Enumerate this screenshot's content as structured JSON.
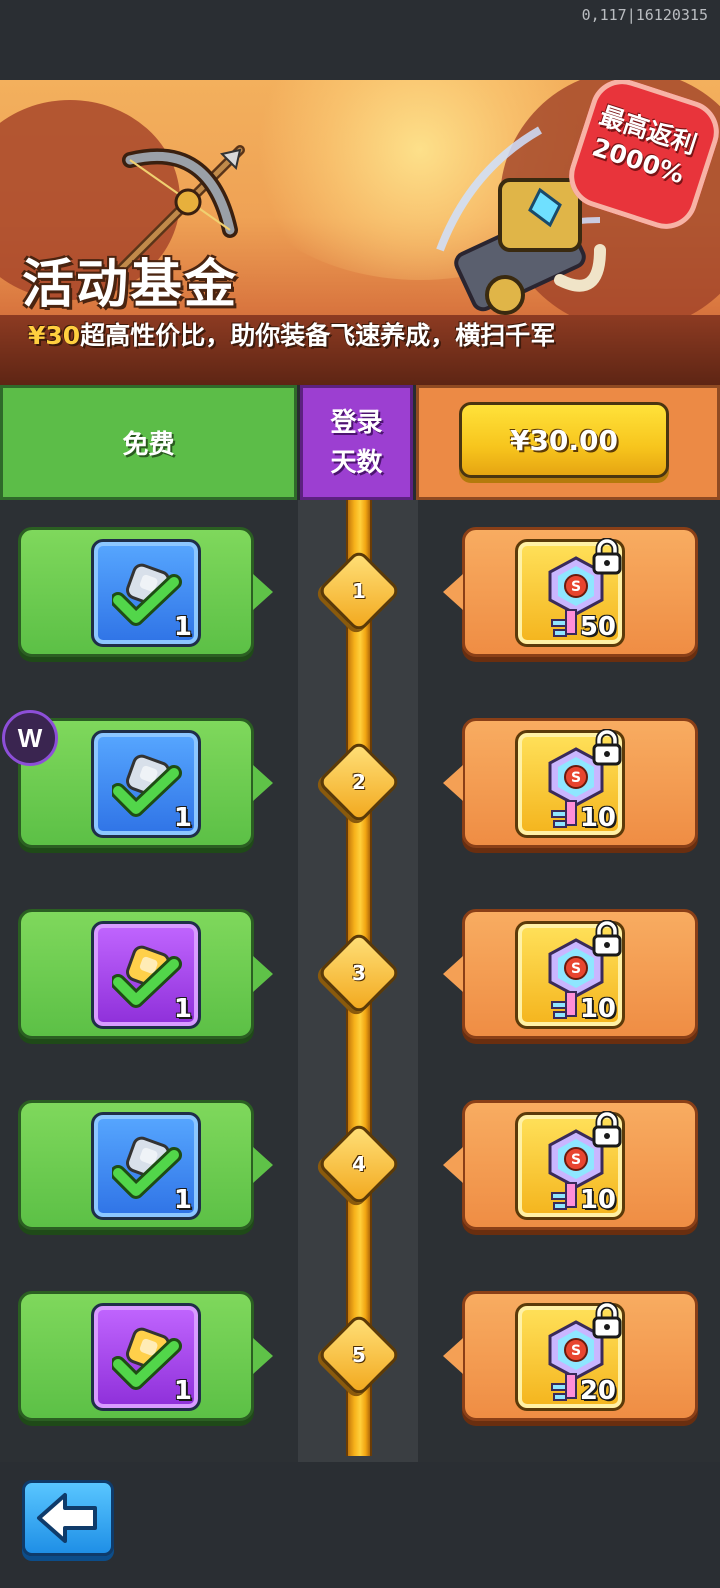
{
  "status_bar": {
    "debug_text": "0,117|16120315"
  },
  "banner": {
    "title": "活动基金",
    "subtitle_price": "¥30",
    "subtitle_text": "超高性价比，助你装备飞速养成，横扫千军",
    "badge_line1": "最高返利",
    "badge_line2": "2000%"
  },
  "header": {
    "free_label": "免费",
    "days_label_line1": "登录",
    "days_label_line2": "天数",
    "price_button": "¥30.00"
  },
  "rows": [
    {
      "day": "1",
      "free_item": {
        "icon": "blue-check-item-icon",
        "qty": "1"
      },
      "paid_item": {
        "icon": "rainbow-key-icon",
        "qty": "50",
        "locked": true
      }
    },
    {
      "day": "2",
      "free_item": {
        "icon": "blue-check-item-icon",
        "qty": "1"
      },
      "paid_item": {
        "icon": "rainbow-key-icon",
        "qty": "10",
        "locked": true
      }
    },
    {
      "day": "3",
      "free_item": {
        "icon": "purple-check-item-icon",
        "qty": "1"
      },
      "paid_item": {
        "icon": "rainbow-key-icon",
        "qty": "10",
        "locked": true
      }
    },
    {
      "day": "4",
      "free_item": {
        "icon": "blue-check-item-icon",
        "qty": "1"
      },
      "paid_item": {
        "icon": "rainbow-key-icon",
        "qty": "10",
        "locked": true
      }
    },
    {
      "day": "5",
      "free_item": {
        "icon": "purple-check-item-icon",
        "qty": "1"
      },
      "paid_item": {
        "icon": "rainbow-key-icon",
        "qty": "20",
        "locked": true
      }
    }
  ],
  "colors": {
    "free": "#5cbd48",
    "days": "#9c3fd1",
    "paid": "#ec8a45",
    "price_button": "#f7c51d",
    "rail": "#f7b21b"
  }
}
